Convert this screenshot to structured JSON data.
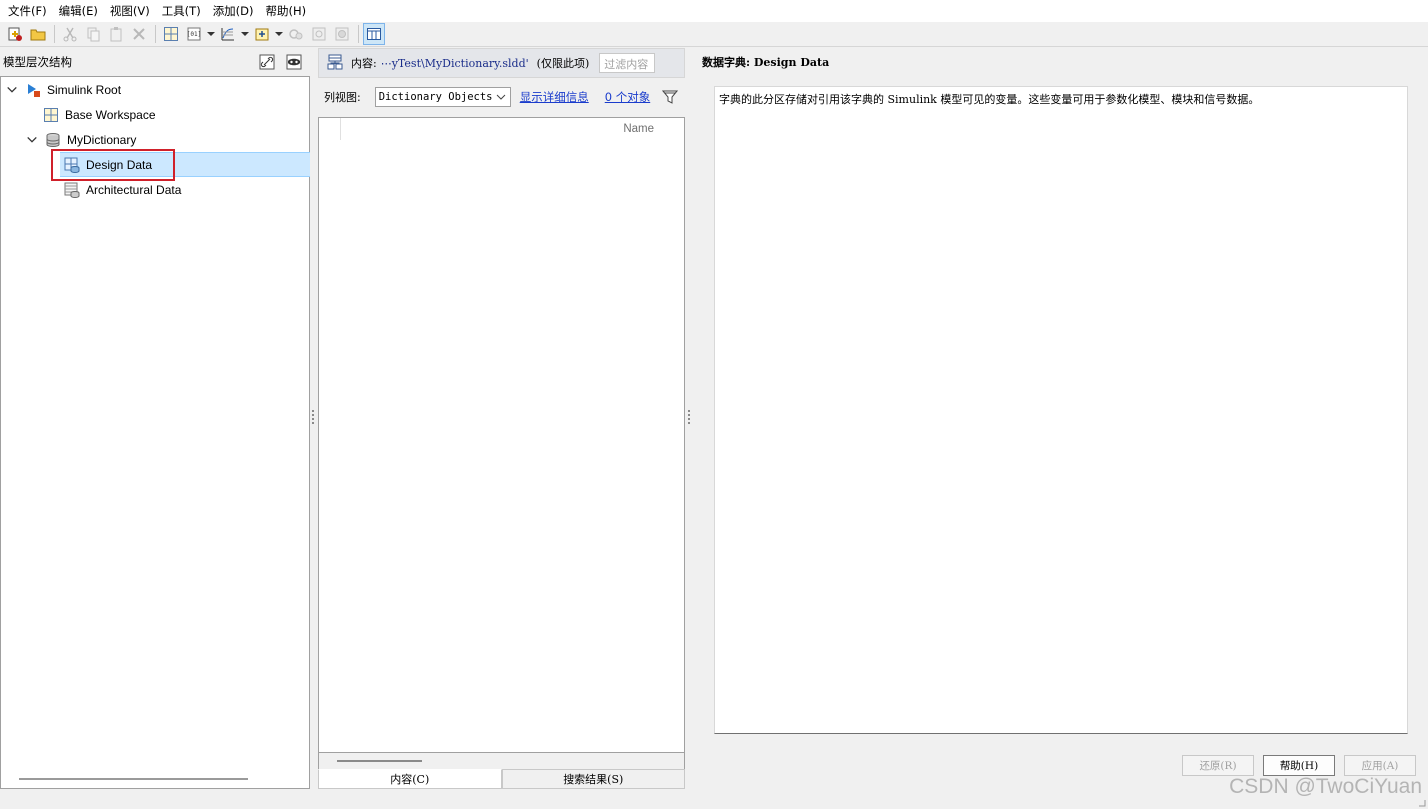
{
  "menubar": {
    "items": [
      "文件(F)",
      "编辑(E)",
      "视图(V)",
      "工具(T)",
      "添加(D)",
      "帮助(H)"
    ]
  },
  "left_panel": {
    "title": "模型层次结构",
    "tree": [
      {
        "label": "Simulink Root",
        "icon": "simulink-root-icon",
        "expanded": true
      },
      {
        "label": "Base Workspace",
        "icon": "workspace-grid-icon"
      },
      {
        "label": "MyDictionary",
        "icon": "database-icon",
        "expanded": true
      },
      {
        "label": "Design Data",
        "icon": "design-data-icon",
        "selected": true
      },
      {
        "label": "Architectural Data",
        "icon": "architectural-data-icon"
      }
    ]
  },
  "middle_panel": {
    "content_label": "内容:",
    "path": "⋯yTest\\MyDictionary.sldd'",
    "scope": "(仅限此项)",
    "filter_placeholder": "过滤内容",
    "column_view_label": "列视图:",
    "column_view_value": "Dictionary Objects",
    "show_details_link": "显示详细信息",
    "object_count_link": "0 个对象",
    "column_header": "Name",
    "tabs": [
      "内容(C)",
      "搜索结果(S)"
    ]
  },
  "right_panel": {
    "title": "数据字典: Design Data",
    "description": "字典的此分区存储对引用该字典的 Simulink 模型可见的变量。这些变量可用于参数化模型、模块和信号数据。",
    "buttons": {
      "revert": "还原(R)",
      "help": "帮助(H)",
      "apply": "应用(A)"
    }
  },
  "watermark": "CSDN @TwoCiYuan",
  "colors": {
    "selection": "#cce8ff",
    "highlight_box": "#d0202a",
    "link": "#1a3ccc"
  }
}
